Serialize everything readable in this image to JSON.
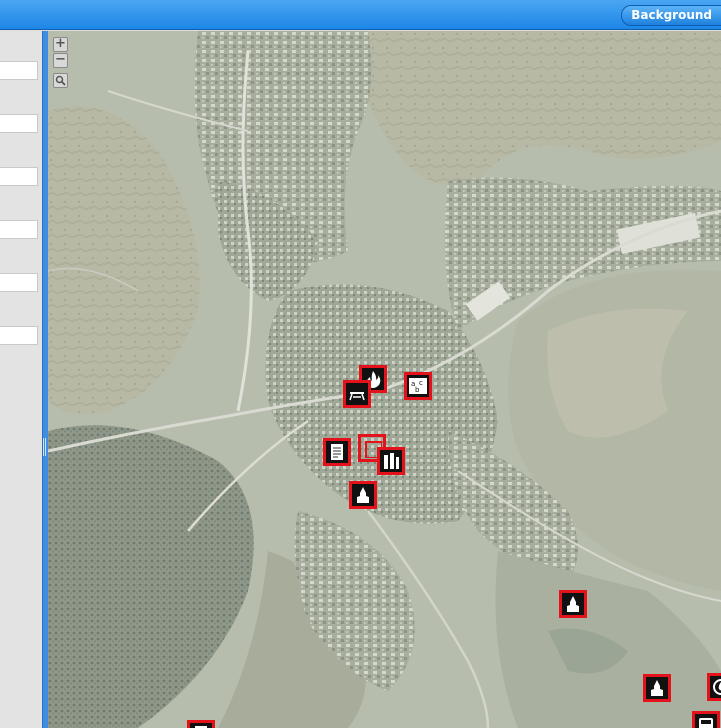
{
  "toolbar": {
    "background_button_label": "Background"
  },
  "sidebar": {
    "field_count": 6
  },
  "map": {
    "zoom_in_symbol": "+",
    "zoom_out_symbol": "−",
    "search_icon": "magnifier",
    "marker_border_color": "#e4121a",
    "markers": [
      {
        "name": "fire-icon"
      },
      {
        "name": "picnic-icon"
      },
      {
        "name": "school-abc-icon"
      },
      {
        "name": "document-icon"
      },
      {
        "name": "overlap-marker-icon"
      },
      {
        "name": "building-icon"
      },
      {
        "name": "church-icon"
      },
      {
        "name": "church-icon"
      },
      {
        "name": "church-icon"
      },
      {
        "name": "fire-icon"
      },
      {
        "name": "bus-icon"
      },
      {
        "name": "document-icon"
      }
    ]
  }
}
